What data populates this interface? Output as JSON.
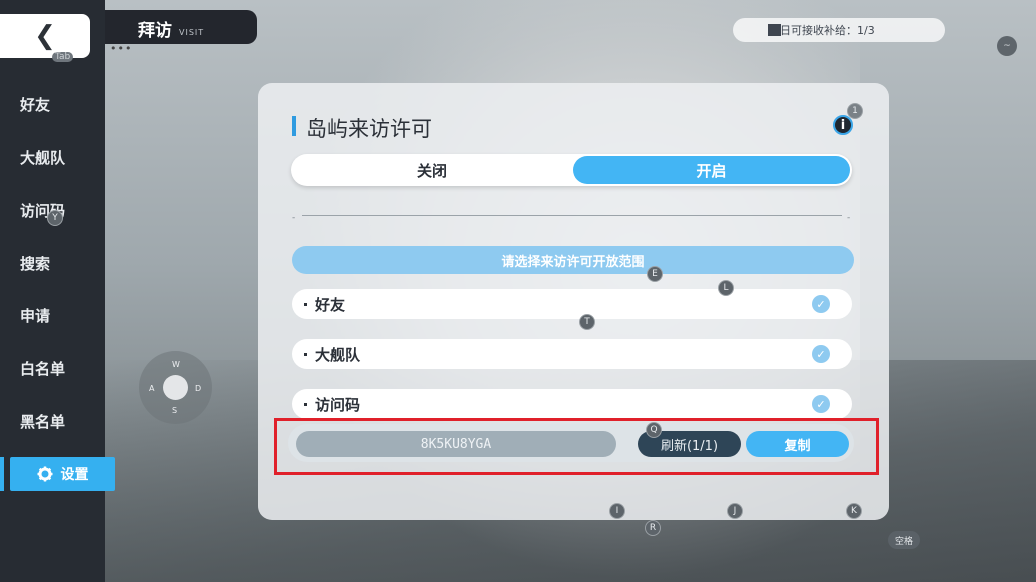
{
  "header": {
    "title": "拜访",
    "subtitle": "VISIT",
    "supply_text": "今日可接收补给：1/3"
  },
  "back": {
    "icon": "chevron-left-icon",
    "hint": "Tab"
  },
  "sidebar": {
    "items": [
      {
        "label": "好友"
      },
      {
        "label": "大舰队"
      },
      {
        "label": "访问码"
      },
      {
        "label": "搜索"
      },
      {
        "label": "申请"
      },
      {
        "label": "白名单"
      },
      {
        "label": "黑名单"
      }
    ],
    "active": {
      "label": "设置",
      "icon": "gear-icon"
    }
  },
  "joystick": {
    "up": "W",
    "left": "A",
    "right": "D",
    "down": "S"
  },
  "panel": {
    "title": "岛屿来访许可",
    "info_badge": "1",
    "toggle": {
      "off_label": "关闭",
      "on_label": "开启",
      "selected": "开启"
    },
    "range_label": "请选择来访许可开放范围",
    "options": [
      {
        "label": "好友",
        "checked": true
      },
      {
        "label": "大舰队",
        "checked": true
      },
      {
        "label": "访问码",
        "checked": true
      }
    ],
    "code": "8K5KU8YGA",
    "refresh_label": "刷新(1/1)",
    "copy_label": "复制"
  },
  "key_hints": {
    "y": "Y",
    "e": "E",
    "l": "L",
    "t": "T",
    "q": "Q",
    "i": "I",
    "r": "R",
    "j": "J",
    "k": "K",
    "space": "空格",
    "tilde": "~"
  },
  "colors": {
    "accent": "#43b5f4",
    "sidebar_bg": "#272c33",
    "highlight_box": "#e0202a"
  }
}
